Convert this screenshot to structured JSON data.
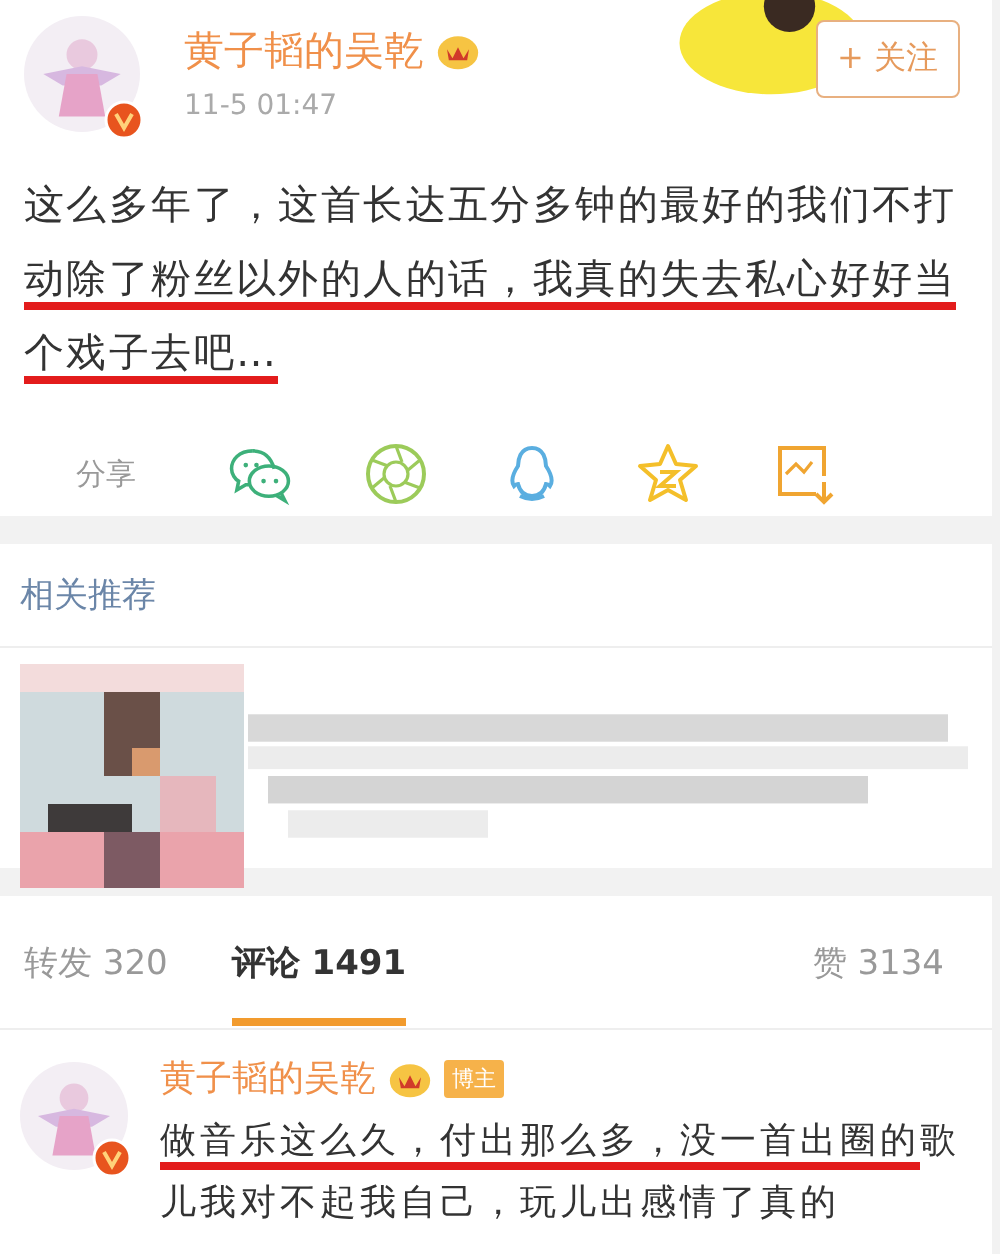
{
  "post": {
    "author": "黄子韬的吴乾",
    "verified": true,
    "time": "11-5 01:47",
    "follow_button": "+ 关注",
    "text": [
      {
        "text": "这么多年了，这首长达五分多钟的最好的我们不打",
        "underlined": false
      },
      {
        "text": "动除了粉丝以外的人的话，我真的失去私心好好当个戏子去吧…",
        "underlined": true
      }
    ],
    "share_label": "分享"
  },
  "recommend": {
    "title": "相关推荐"
  },
  "tabs": [
    {
      "label": "转发 320",
      "selected": false
    },
    {
      "label": "评论 1491",
      "selected": true
    },
    {
      "label": "赞 3134",
      "selected": false
    }
  ],
  "comment": {
    "author": "黄子韬的吴乾",
    "verified": true,
    "badge": "博主",
    "text": [
      {
        "text": "做音乐这么久，付出那么多，没一首出圈的",
        "underlined": true
      },
      {
        "text": "歌儿我对不起我自己，玩儿出感情了真的",
        "underlined": false
      }
    ]
  }
}
